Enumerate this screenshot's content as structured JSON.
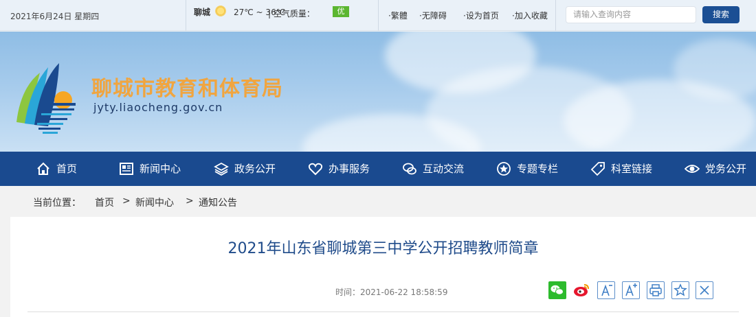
{
  "topbar": {
    "date": "2021年6月24日 星期四",
    "city": "聊城",
    "temperature": "27℃ ~ 36℃",
    "aqi_label": "| 空气质量：",
    "aqi_value": "优",
    "aqi_color": "#5bb631",
    "links": [
      "·繁體",
      "·无障碍",
      "·设为首页",
      "·加入收藏"
    ],
    "search_placeholder": "请输入查询内容",
    "search_button": "搜索"
  },
  "banner": {
    "title": "聊城市教育和体育局",
    "url": "jyty.liaocheng.gov.cn",
    "logo_icon": "bureau-logo-icon"
  },
  "nav": {
    "items": [
      {
        "label": "首页",
        "icon": "home-icon"
      },
      {
        "label": "新闻中心",
        "icon": "newspaper-icon"
      },
      {
        "label": "政务公开",
        "icon": "layers-icon"
      },
      {
        "label": "办事服务",
        "icon": "heart-icon"
      },
      {
        "label": "互动交流",
        "icon": "chat-icon"
      },
      {
        "label": "专题专栏",
        "icon": "star-circle-icon"
      },
      {
        "label": "科室链接",
        "icon": "tag-icon"
      },
      {
        "label": "党务公开",
        "icon": "eye-icon"
      }
    ]
  },
  "breadcrumb": {
    "prefix": "当前位置：",
    "items": [
      "首页",
      "新闻中心",
      "通知公告"
    ],
    "separator": ">"
  },
  "article": {
    "title": "2021年山东省聊城第三中学公开招聘教师简章",
    "time": "时间：2021-06-22 18:58:59",
    "tools": [
      "wechat-share-icon",
      "weibo-share-icon",
      "font-decrease-icon",
      "font-increase-icon",
      "print-icon",
      "favorite-icon",
      "close-icon"
    ]
  },
  "colors": {
    "nav_bg": "#1a4a8f",
    "title_orange": "#f0a540",
    "article_title": "#1f4b8a"
  }
}
